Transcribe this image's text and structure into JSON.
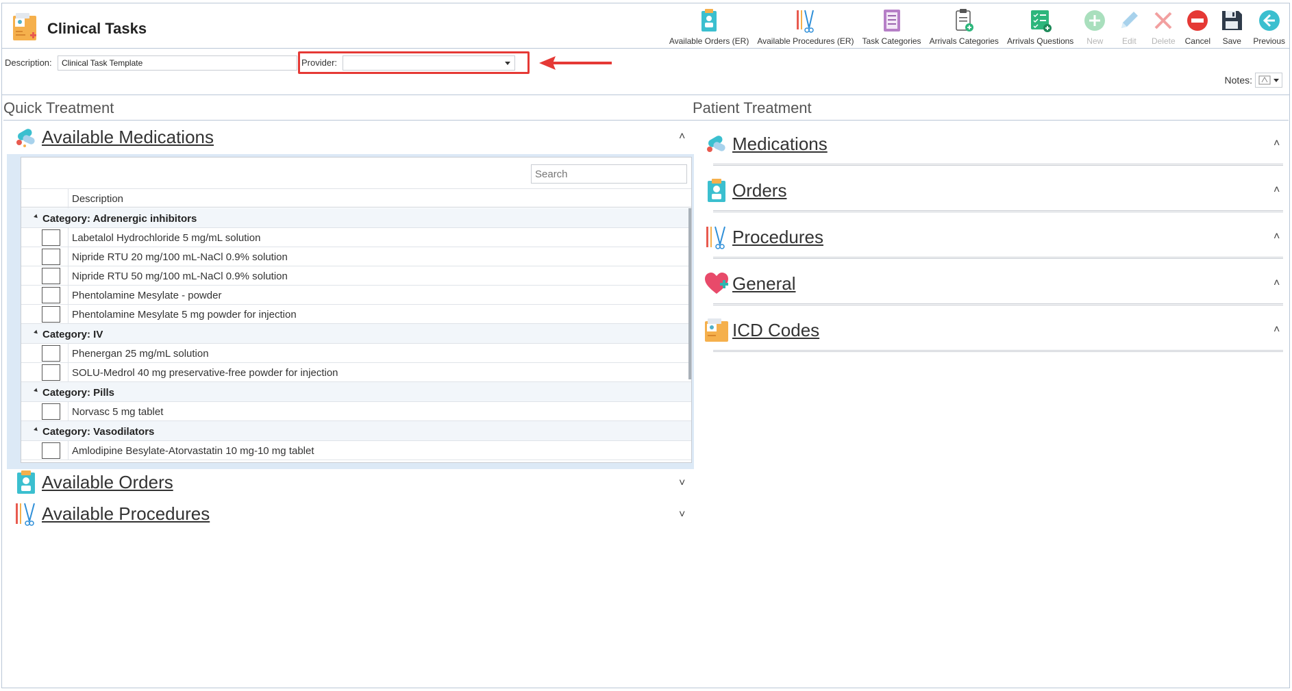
{
  "app": {
    "title": "Clinical Tasks"
  },
  "toolbar": [
    {
      "label": "Available Orders (ER)",
      "icon": "clipboard-doctor-icon",
      "enabled": true
    },
    {
      "label": "Available Procedures (ER)",
      "icon": "surgical-tools-icon",
      "enabled": true
    },
    {
      "label": "Task Categories",
      "icon": "list-document-icon",
      "enabled": true
    },
    {
      "label": "Arrivals Categories",
      "icon": "clipboard-add-icon",
      "enabled": true
    },
    {
      "label": "Arrivals Questions",
      "icon": "checklist-add-icon",
      "enabled": true
    },
    {
      "label": "New",
      "icon": "plus-circle-icon",
      "enabled": false
    },
    {
      "label": "Edit",
      "icon": "pencil-icon",
      "enabled": false
    },
    {
      "label": "Delete",
      "icon": "x-icon",
      "enabled": false
    },
    {
      "label": "Cancel",
      "icon": "no-entry-icon",
      "enabled": true
    },
    {
      "label": "Save",
      "icon": "floppy-disk-icon",
      "enabled": true
    },
    {
      "label": "Previous",
      "icon": "arrow-left-circle-icon",
      "enabled": true
    }
  ],
  "form": {
    "description_label": "Description:",
    "description_value": "Clinical Task Template",
    "provider_label": "Provider:",
    "provider_value": "",
    "notes_label": "Notes:"
  },
  "quick_treatment": {
    "title": "Quick Treatment",
    "medications": {
      "label": "Available Medications",
      "search_placeholder": "Search",
      "column_header": "Description",
      "groups": [
        {
          "category": "Category: Adrenergic inhibitors",
          "items": [
            "Labetalol Hydrochloride 5 mg/mL solution",
            "Nipride RTU 20 mg/100 mL-NaCl 0.9% solution",
            "Nipride RTU 50 mg/100 mL-NaCl 0.9% solution",
            "Phentolamine Mesylate - powder",
            "Phentolamine Mesylate 5 mg powder for injection"
          ]
        },
        {
          "category": "Category: IV",
          "items": [
            "Phenergan 25 mg/mL solution",
            "SOLU-Medrol 40 mg preservative-free powder for injection"
          ]
        },
        {
          "category": "Category: Pills",
          "items": [
            "Norvasc 5 mg tablet"
          ]
        },
        {
          "category": "Category: Vasodilators",
          "items": [
            "Amlodipine Besylate-Atorvastatin 10 mg-10 mg tablet"
          ]
        }
      ]
    },
    "orders_label": "Available Orders",
    "procedures_label": "Available Procedures"
  },
  "patient_treatment": {
    "title": "Patient Treatment",
    "sections": [
      {
        "label": "Medications",
        "icon": "pills-icon"
      },
      {
        "label": "Orders",
        "icon": "clipboard-doctor-icon"
      },
      {
        "label": "Procedures",
        "icon": "surgical-tools-icon"
      },
      {
        "label": "General",
        "icon": "heart-plus-icon"
      },
      {
        "label": "ICD Codes",
        "icon": "medical-folder-icon"
      }
    ]
  },
  "colors": {
    "highlight": "#e53935",
    "accent": "#b9c6d6",
    "panel": "#dce9f6"
  }
}
